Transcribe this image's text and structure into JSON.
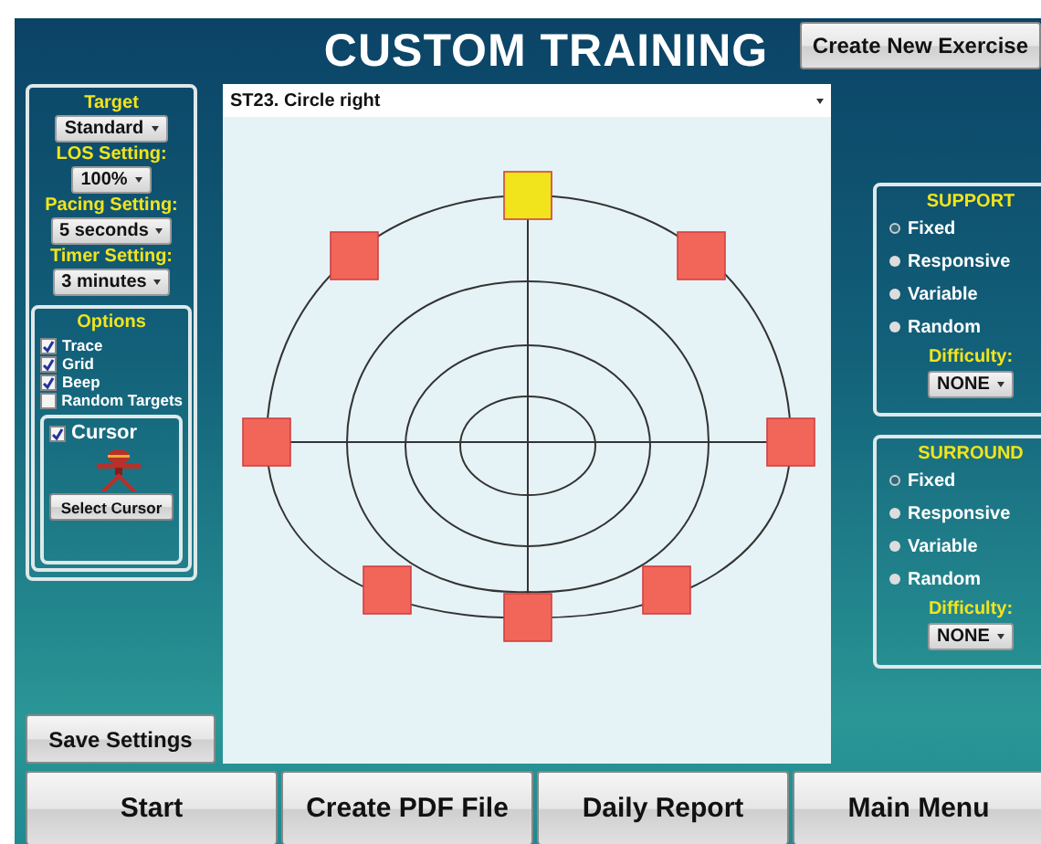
{
  "title": "CUSTOM TRAINING",
  "create_button": "Create New Exercise",
  "settings": [
    {
      "label": "Target",
      "value": "Standard"
    },
    {
      "label": "LOS Setting:",
      "value": "100%"
    },
    {
      "label": "Pacing Setting:",
      "value": "5 seconds"
    },
    {
      "label": "Timer Setting:",
      "value": "3 minutes"
    }
  ],
  "options": {
    "title": "Options",
    "items": [
      {
        "label": "Trace",
        "checked": true
      },
      {
        "label": "Grid",
        "checked": true
      },
      {
        "label": "Beep",
        "checked": true
      },
      {
        "label": "Random Targets",
        "checked": false
      }
    ],
    "cursor": {
      "label": "Cursor",
      "checked": true,
      "button": "Select Cursor"
    }
  },
  "save_button": "Save Settings",
  "exercise": "ST23. Circle right",
  "targets": [
    {
      "color": "#f2e41c"
    },
    {
      "color": "#f2665a"
    },
    {
      "color": "#f2665a"
    },
    {
      "color": "#f2665a"
    },
    {
      "color": "#f2665a"
    },
    {
      "color": "#f2665a"
    },
    {
      "color": "#f2665a"
    },
    {
      "color": "#f2665a"
    }
  ],
  "modes": [
    {
      "title": "SUPPORT",
      "options": [
        {
          "label": "Fixed",
          "selected": true
        },
        {
          "label": "Responsive",
          "selected": false
        },
        {
          "label": "Variable",
          "selected": false
        },
        {
          "label": "Random",
          "selected": false
        }
      ],
      "difficulty_label": "Difficulty:",
      "difficulty": "NONE"
    },
    {
      "title": "SURROUND",
      "options": [
        {
          "label": "Fixed",
          "selected": true
        },
        {
          "label": "Responsive",
          "selected": false
        },
        {
          "label": "Variable",
          "selected": false
        },
        {
          "label": "Random",
          "selected": false
        }
      ],
      "difficulty_label": "Difficulty:",
      "difficulty": "NONE"
    }
  ],
  "buttons": [
    "Start",
    "Create PDF File",
    "Daily Report",
    "Main Menu"
  ]
}
